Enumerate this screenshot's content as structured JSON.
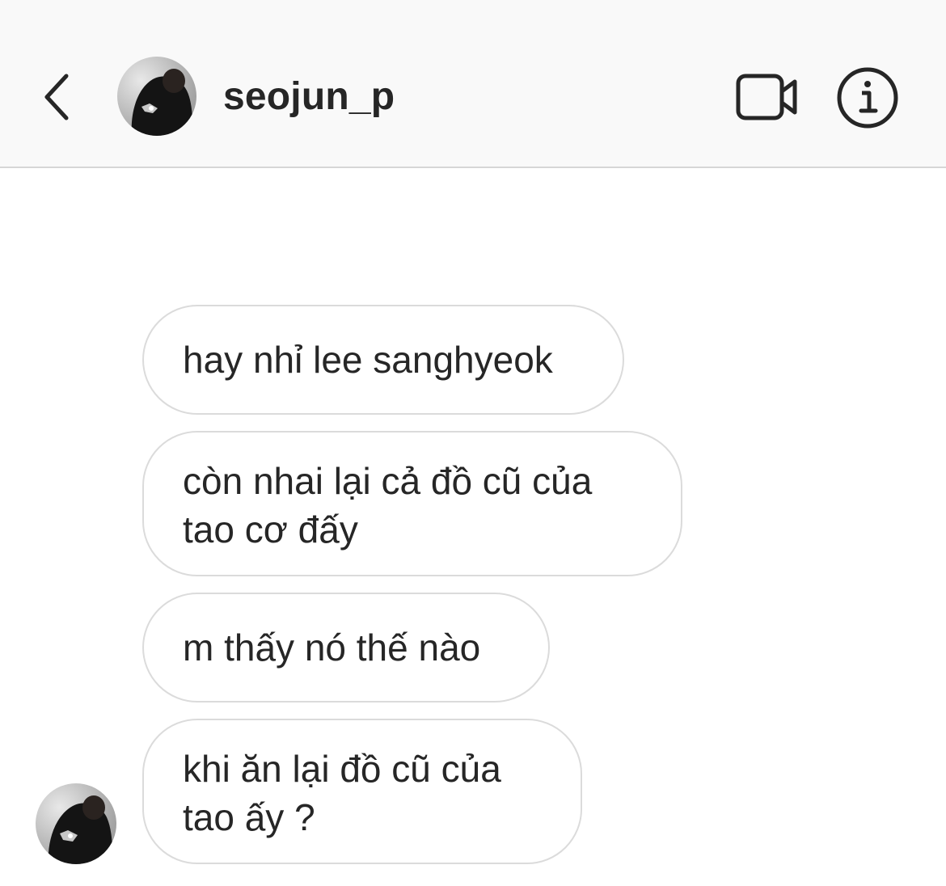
{
  "header": {
    "username": "seojun_p",
    "back_icon": "chevron-left-icon",
    "video_icon": "video-camera-icon",
    "info_icon": "info-icon"
  },
  "messages": [
    {
      "text": "hay nhỉ lee sanghyeok"
    },
    {
      "text": "còn nhai lại cả đồ cũ của\ntao cơ đấy"
    },
    {
      "text": "m thấy nó thế nào"
    },
    {
      "text": "khi ăn lại đồ cũ của\ntao ấy ?"
    }
  ],
  "colors": {
    "header_bg": "#f9f9f9",
    "bubble_border": "#dbdbdb",
    "text": "#262626"
  }
}
